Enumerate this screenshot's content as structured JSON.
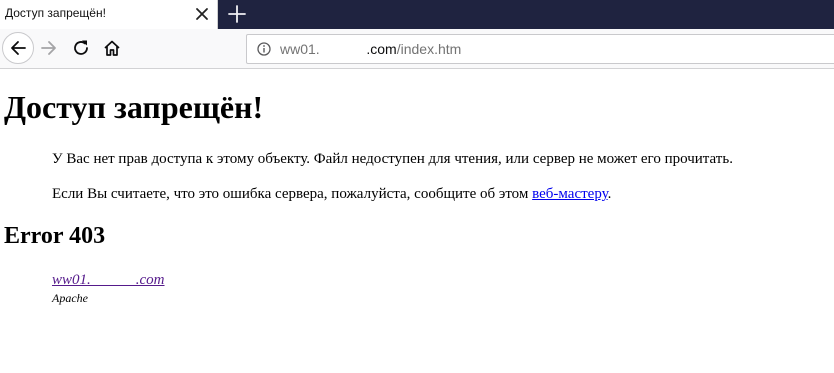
{
  "browser": {
    "tab": {
      "title": "Доступ запрещён!"
    },
    "url": {
      "prefix": "ww01.",
      "redacted": "            ",
      "domain": ".com",
      "path": "/index.htm"
    }
  },
  "page": {
    "heading": "Доступ запрещён!",
    "paragraph1": "У Вас нет прав доступа к этому объекту. Файл недоступен для чтения, или сервер не может его прочитать.",
    "paragraph2_before": "Если Вы считаете, что это ошибка сервера, пожалуйста, сообщите об этом ",
    "paragraph2_link": "веб-мастеру",
    "paragraph2_after": ".",
    "error_heading": "Error 403",
    "footer_link": "ww01.            .com",
    "footer_server": "Apache"
  },
  "colors": {
    "tabstrip": "#1f2340",
    "link": "#0000ee",
    "visited_link": "#551a8b"
  },
  "icons": [
    "close-icon",
    "plus-icon",
    "back-arrow-icon",
    "forward-arrow-icon",
    "reload-icon",
    "home-icon",
    "info-icon"
  ]
}
